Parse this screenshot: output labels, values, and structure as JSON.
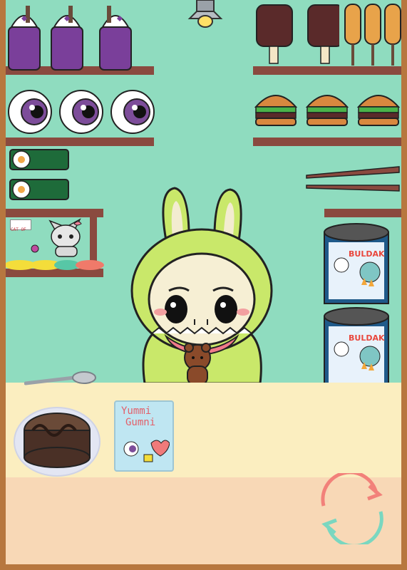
{
  "scene": {
    "name": "snack-shop-counter",
    "colors": {
      "wall": "#8fdcbf",
      "frame": "#b7773f",
      "shelf": "#8a4a3f",
      "counter": "#fbeec0",
      "floor": "#f8d8b6"
    }
  },
  "shelves": {
    "top_left": [
      "smoothie-jar",
      "smoothie-jar",
      "smoothie-jar"
    ],
    "top_right_icecream": [
      "ice-cream-bar",
      "ice-cream-bar"
    ],
    "top_right_corndogs": [
      "corn-dog",
      "corn-dog",
      "corn-dog"
    ],
    "eyes": [
      "eyeball-candy",
      "eyeball-candy",
      "eyeball-candy"
    ],
    "burgers": [
      "burger",
      "burger",
      "burger"
    ],
    "sushi": [
      "sushi-roll",
      "sushi-roll"
    ],
    "chopsticks": [
      "chopsticks"
    ]
  },
  "character": {
    "name": "bunny-hood-character",
    "holding": "teddy-bear"
  },
  "small_pet": {
    "name": "kitten",
    "sign": "CAT OF"
  },
  "cans": {
    "label": "BULDAK",
    "count": 2
  },
  "counter_items": {
    "cake": "chocolate-cake",
    "gumni_pack": {
      "line1": "Yummi",
      "line2": "Gumni"
    },
    "spoon": "spoon"
  },
  "controls": {
    "refresh": "refresh-icon"
  }
}
